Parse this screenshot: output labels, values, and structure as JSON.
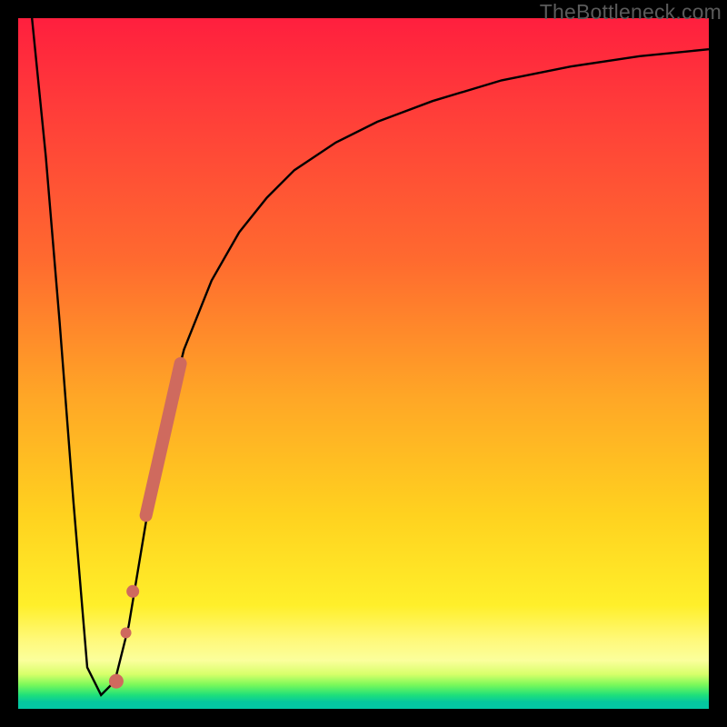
{
  "watermark": "TheBottleneck.com",
  "chart_data": {
    "type": "line",
    "title": "",
    "xlabel": "",
    "ylabel": "",
    "xlim": [
      0,
      100
    ],
    "ylim": [
      0,
      100
    ],
    "series": [
      {
        "name": "bottleneck-curve",
        "x": [
          2,
          4,
          6,
          8,
          10,
          12,
          14,
          16,
          18,
          20,
          24,
          28,
          32,
          36,
          40,
          46,
          52,
          60,
          70,
          80,
          90,
          100
        ],
        "y": [
          100,
          80,
          56,
          30,
          6,
          2,
          4,
          12,
          24,
          36,
          52,
          62,
          69,
          74,
          78,
          82,
          85,
          88,
          91,
          93,
          94.5,
          95.5
        ]
      }
    ],
    "markers": {
      "name": "highlight-segment",
      "color": "#cf6a5e",
      "bar": {
        "x1": 18.5,
        "y1": 28,
        "x2": 23.5,
        "y2": 50
      },
      "dots": [
        {
          "x": 16.6,
          "y": 17
        },
        {
          "x": 15.6,
          "y": 11
        },
        {
          "x": 14.2,
          "y": 4
        }
      ]
    },
    "background": {
      "type": "heatmap-gradient",
      "top_color": "#ff1f3e",
      "mid_color": "#ffd21f",
      "bottom_color": "#05c79e"
    }
  }
}
